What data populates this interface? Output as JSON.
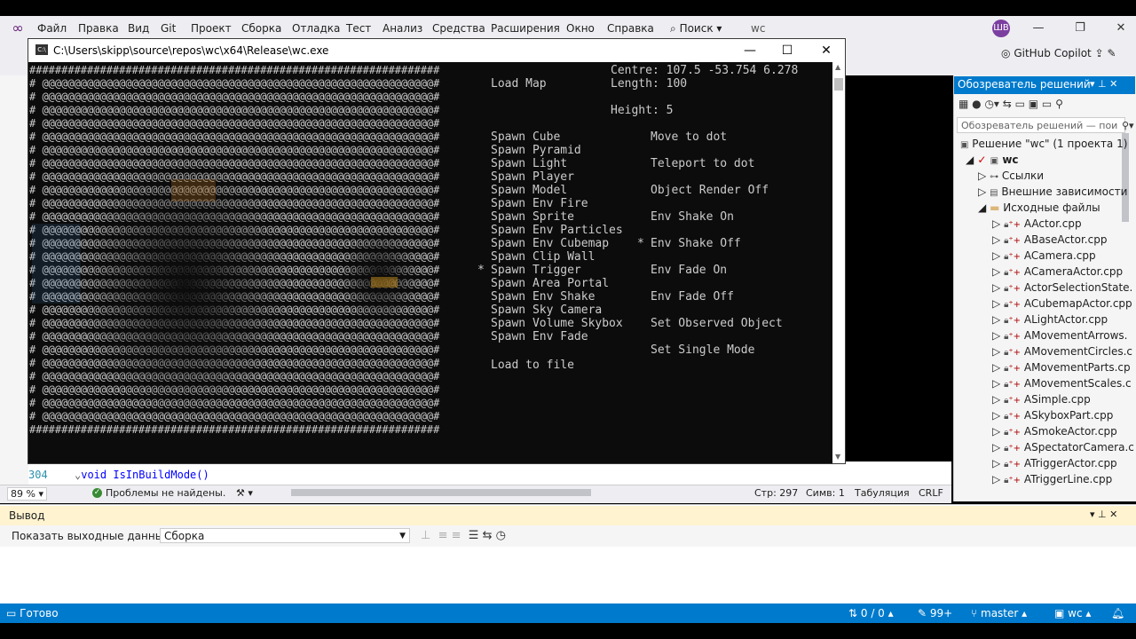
{
  "menu": {
    "items": [
      "Файл",
      "Правка",
      "Вид",
      "Git",
      "Проект",
      "Сборка",
      "Отладка",
      "Тест",
      "Анализ",
      "Средства",
      "Расширения",
      "Окно",
      "Справка"
    ],
    "search": "Поиск",
    "solution_name": "wc",
    "avatar": "ШВ",
    "copilot": "GitHub Copilot"
  },
  "console": {
    "title": "C:\\Users\\skipp\\source\\repos\\wc\\x64\\Release\\wc.exe",
    "info": {
      "centre": "Centre: 107.5 -53.754 6.278",
      "length": "Length: 100",
      "height": "Height: 5",
      "load_map": "Load Map"
    },
    "left_menu": [
      {
        "label": "Spawn Cube",
        "selected": false
      },
      {
        "label": "Spawn Pyramid",
        "selected": false
      },
      {
        "label": "Spawn Light",
        "selected": false
      },
      {
        "label": "Spawn Player",
        "selected": false
      },
      {
        "label": "Spawn Model",
        "selected": false
      },
      {
        "label": "Spawn Env Fire",
        "selected": false
      },
      {
        "label": "Spawn Sprite",
        "selected": false
      },
      {
        "label": "Spawn Env Particles",
        "selected": false
      },
      {
        "label": "Spawn Env Cubemap",
        "selected": false
      },
      {
        "label": "Spawn Clip Wall",
        "selected": false
      },
      {
        "label": "Spawn Trigger",
        "selected": true
      },
      {
        "label": "Spawn Area Portal",
        "selected": false
      },
      {
        "label": "Spawn Env Shake",
        "selected": false
      },
      {
        "label": "Spawn Sky Camera",
        "selected": false
      },
      {
        "label": "Spawn Volume Skybox",
        "selected": false
      },
      {
        "label": "Spawn Env Fade",
        "selected": false
      }
    ],
    "load_to_file": "Load to file",
    "right_menu": [
      {
        "label": "Move to dot",
        "row": 0,
        "selected": false
      },
      {
        "label": "Teleport to dot",
        "row": 2,
        "selected": false
      },
      {
        "label": "Object Render Off",
        "row": 4,
        "selected": false
      },
      {
        "label": "Env Shake On",
        "row": 6,
        "selected": false
      },
      {
        "label": "Env Shake Off",
        "row": 8,
        "selected": true
      },
      {
        "label": "Env Fade On",
        "row": 10,
        "selected": false
      },
      {
        "label": "Env Fade Off",
        "row": 12,
        "selected": false
      },
      {
        "label": "Set Observed Object",
        "row": 14,
        "selected": false
      },
      {
        "label": "Set Single Mode",
        "row": 16,
        "selected": false
      }
    ],
    "marker": "*"
  },
  "editor": {
    "line_number": "304",
    "code": "void IsInBuildMode()",
    "zoom": "89 %",
    "problems": "Проблемы не найдены.",
    "line": "Стр: 297",
    "col": "Симв: 1",
    "tabs": "Табуляция",
    "eol": "CRLF"
  },
  "output": {
    "title": "Вывод",
    "show_from": "Показать выходные данные из:",
    "source": "Сборка"
  },
  "solution_explorer": {
    "title": "Обозреватель решений",
    "search_placeholder": "Обозреватель решений — пои",
    "solution": "Решение \"wc\"  (1 проекта 1)",
    "project": "wc",
    "nodes": [
      "Ссылки",
      "Внешние зависимости",
      "Исходные файлы"
    ],
    "files": [
      "AActor.cpp",
      "ABaseActor.cpp",
      "ACamera.cpp",
      "ACameraActor.cpp",
      "ActorSelectionState.",
      "ACubemapActor.cpp",
      "ALightActor.cpp",
      "AMovementArrows.",
      "AMovementCircles.c",
      "AMovementParts.cp",
      "AMovementScales.c",
      "ASimple.cpp",
      "ASkyboxPart.cpp",
      "ASmokeActor.cpp",
      "ASpectatorCamera.c",
      "ATriggerActor.cpp",
      "ATriggerLine.cpp"
    ]
  },
  "status": {
    "ready": "Готово",
    "changes": "0 / 0",
    "pending": "99+",
    "branch": "master",
    "repo": "wc"
  },
  "colors": {
    "accent": "#007acc",
    "console_bg": "#0c0c0c",
    "console_text": "#cccccc",
    "output_header": "#fff3d0"
  }
}
